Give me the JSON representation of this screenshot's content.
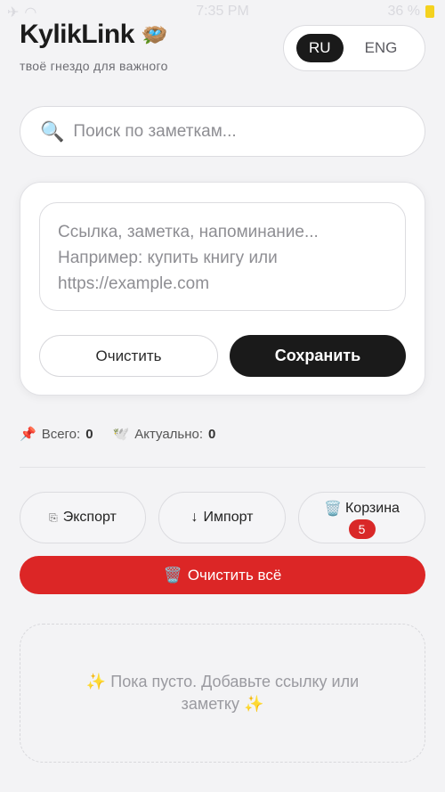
{
  "status_bar": {
    "time": "7:35 PM",
    "battery": "36 %"
  },
  "header": {
    "title": "KylikLink",
    "icon": "🪺",
    "subtitle": "твоё гнездо для важного"
  },
  "language": {
    "active": "RU",
    "inactive": "ENG"
  },
  "search": {
    "icon": "🔍",
    "placeholder": "Поиск по заметкам..."
  },
  "composer": {
    "placeholder": "Ссылка, заметка, напоминание...\nНапример: купить книгу или\nhttps://example.com",
    "clear_label": "Очистить",
    "save_label": "Сохранить"
  },
  "stats": {
    "total_icon": "📌",
    "total_label": "Всего:",
    "total_value": "0",
    "actual_icon": "🕊️",
    "actual_label": "Актуально:",
    "actual_value": "0"
  },
  "actions": {
    "export_icon": "⎘",
    "export_label": "Экспорт",
    "import_icon": "↓",
    "import_label": "Импорт",
    "trash_icon": "🗑️",
    "trash_label": "Корзина",
    "trash_count": "5",
    "clear_all_icon": "🗑️",
    "clear_all_label": "Очистить всё"
  },
  "empty_state": {
    "message": "✨ Пока пусто. Добавьте ссылку или заметку ✨"
  },
  "colors": {
    "background": "#f3f3f5",
    "primary": "#1a1a1a",
    "danger": "#dc2626",
    "battery": "#f4d21f"
  }
}
